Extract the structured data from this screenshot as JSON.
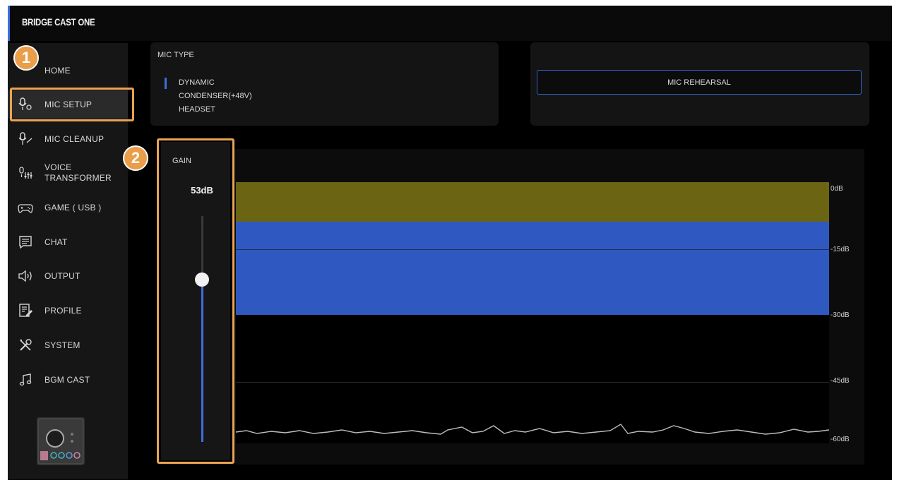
{
  "app": {
    "title": "BRIDGE CAST ONE"
  },
  "sidebar": {
    "items": [
      {
        "label": "HOME",
        "icon": "home-icon"
      },
      {
        "label": "MIC SETUP",
        "icon": "mic-setup-icon",
        "active": true
      },
      {
        "label": "MIC CLEANUP",
        "icon": "mic-cleanup-icon"
      },
      {
        "label": "VOICE\nTRANSFORMER",
        "icon": "voice-transformer-icon"
      },
      {
        "label": "GAME ( USB )",
        "icon": "gamepad-icon"
      },
      {
        "label": "CHAT",
        "icon": "chat-icon"
      },
      {
        "label": "OUTPUT",
        "icon": "speaker-icon"
      },
      {
        "label": "PROFILE",
        "icon": "profile-icon"
      },
      {
        "label": "SYSTEM",
        "icon": "tools-icon"
      },
      {
        "label": "BGM CAST",
        "icon": "music-note-icon"
      }
    ],
    "device_icon": "device-thumbnail-icon"
  },
  "mic_type": {
    "title": "MIC TYPE",
    "options": [
      "DYNAMIC",
      "CONDENSER(+48V)",
      "HEADSET"
    ],
    "selected": "DYNAMIC"
  },
  "rehearsal": {
    "label": "MIC REHEARSAL"
  },
  "gain": {
    "label": "GAIN",
    "value_text": "53dB",
    "level_fraction": 0.72
  },
  "meter": {
    "scale_labels": [
      "0dB",
      "-15dB",
      "-30dB",
      "-45dB",
      "-60dB"
    ],
    "bands": [
      {
        "name": "yellow",
        "color": "#6a6413"
      },
      {
        "name": "blue",
        "color": "#2f59c0"
      }
    ]
  },
  "annotations": [
    {
      "number": "1"
    },
    {
      "number": "2"
    }
  ],
  "colors": {
    "accent": "#3b6fe0",
    "highlight": "#e9a452"
  }
}
